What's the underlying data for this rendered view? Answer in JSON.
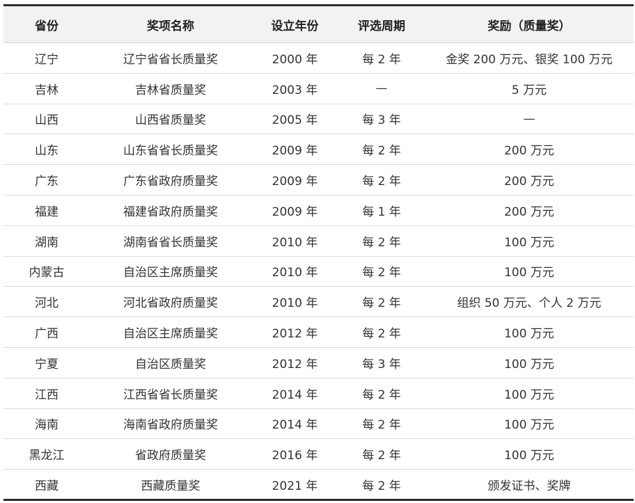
{
  "table": {
    "headers": [
      "省份",
      "奖项名称",
      "设立年份",
      "评选周期",
      "奖励（质量奖）"
    ],
    "rows": [
      [
        "辽宁",
        "辽宁省省长质量奖",
        "2000 年",
        "每 2 年",
        "金奖 200 万元、银奖 100 万元"
      ],
      [
        "吉林",
        "吉林省质量奖",
        "2003 年",
        "—",
        "5 万元"
      ],
      [
        "山西",
        "山西省质量奖",
        "2005 年",
        "每 3 年",
        "—"
      ],
      [
        "山东",
        "山东省省长质量奖",
        "2009 年",
        "每 2 年",
        "200 万元"
      ],
      [
        "广东",
        "广东省政府质量奖",
        "2009 年",
        "每 2 年",
        "200 万元"
      ],
      [
        "福建",
        "福建省政府质量奖",
        "2009 年",
        "每 1 年",
        "200 万元"
      ],
      [
        "湖南",
        "湖南省省长质量奖",
        "2010 年",
        "每 2 年",
        "100 万元"
      ],
      [
        "内蒙古",
        "自治区主席质量奖",
        "2010 年",
        "每 2 年",
        "100 万元"
      ],
      [
        "河北",
        "河北省政府质量奖",
        "2010 年",
        "每 2 年",
        "组织 50 万元、个人 2 万元"
      ],
      [
        "广西",
        "自治区主席质量奖",
        "2012 年",
        "每 2 年",
        "100 万元"
      ],
      [
        "宁夏",
        "自治区质量奖",
        "2012 年",
        "每 3 年",
        "100 万元"
      ],
      [
        "江西",
        "江西省省长质量奖",
        "2014 年",
        "每 2 年",
        "100 万元"
      ],
      [
        "海南",
        "海南省政府质量奖",
        "2014 年",
        "每 2 年",
        "100 万元"
      ],
      [
        "黑龙江",
        "省政府质量奖",
        "2016 年",
        "每 2 年",
        "100 万元"
      ],
      [
        "西藏",
        "西藏质量奖",
        "2021 年",
        "每 2 年",
        "颁发证书、奖牌"
      ]
    ]
  }
}
